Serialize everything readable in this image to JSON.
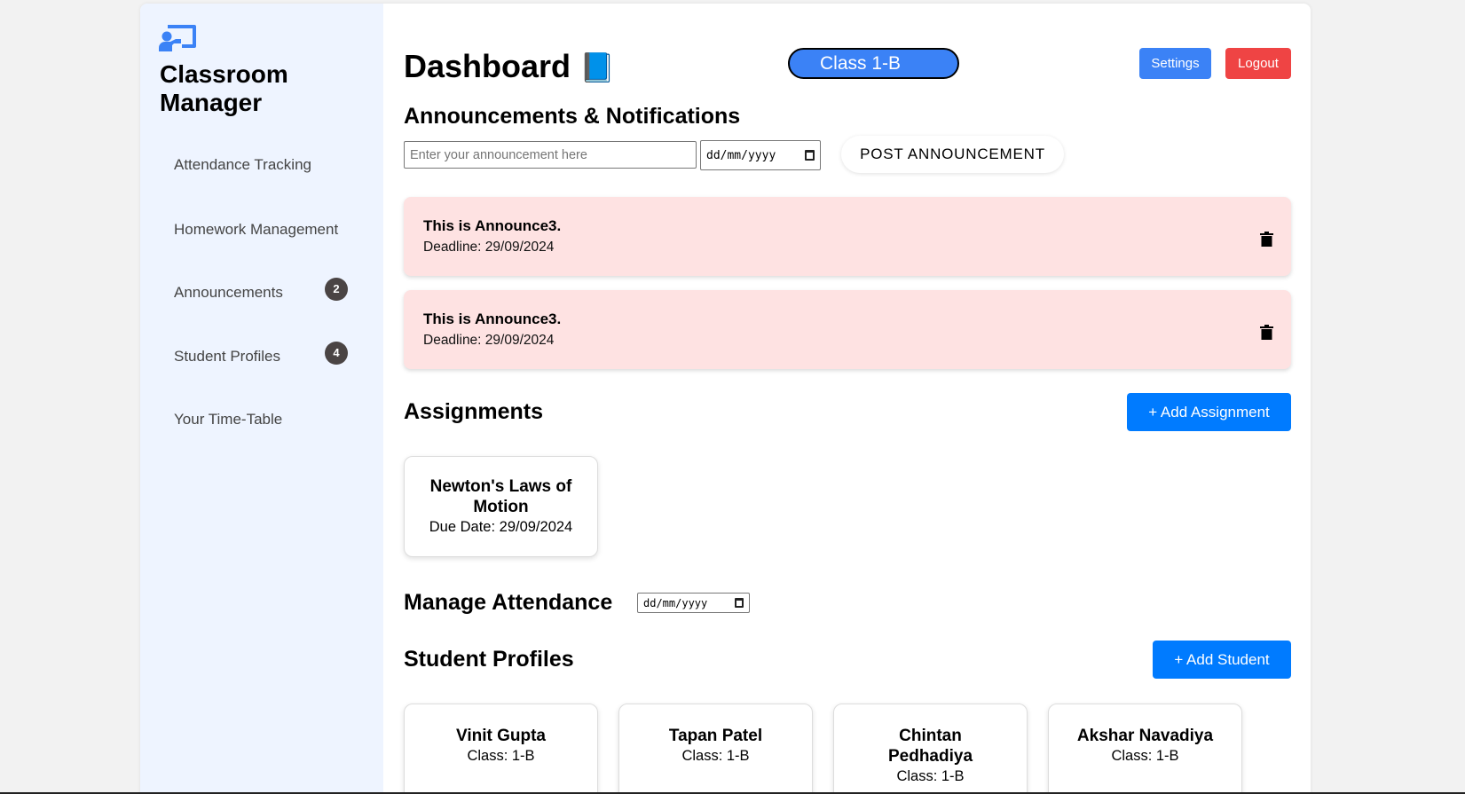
{
  "sidebar": {
    "brand": "Classroom Manager",
    "items": [
      {
        "label": "Attendance Tracking"
      },
      {
        "label": "Homework Management"
      },
      {
        "label": "Announcements",
        "badge": "2"
      },
      {
        "label": "Student Profiles",
        "badge": "4"
      },
      {
        "label": "Your Time-Table"
      }
    ]
  },
  "header": {
    "title": "Dashboard",
    "title_emoji": "📘",
    "class_label": "Class 1-B",
    "settings": "Settings",
    "logout": "Logout"
  },
  "announcements": {
    "heading": "Announcements & Notifications",
    "placeholder": "Enter your announcement here",
    "date_placeholder": "dd/mm/yyyy",
    "post": "POST ANNOUNCEMENT",
    "items": [
      {
        "text": "This is Announce3.",
        "deadline": "Deadline: 29/09/2024"
      },
      {
        "text": "This is Announce3.",
        "deadline": "Deadline: 29/09/2024"
      }
    ]
  },
  "assignments": {
    "heading": "Assignments",
    "add": "+ Add Assignment",
    "items": [
      {
        "title": "Newton's Laws of Motion",
        "due": "Due Date: 29/09/2024"
      }
    ]
  },
  "attendance": {
    "heading": "Manage Attendance",
    "date_placeholder": "dd/mm/yyyy"
  },
  "students": {
    "heading": "Student Profiles",
    "add": "+ Add Student",
    "items": [
      {
        "name": "Vinit Gupta",
        "class": "Class: 1-B"
      },
      {
        "name": "Tapan Patel",
        "class": "Class: 1-B"
      },
      {
        "name": "Chintan Pedhadiya",
        "class": "Class: 1-B"
      },
      {
        "name": "Akshar Navadiya",
        "class": "Class: 1-B"
      }
    ]
  },
  "colors": {
    "primary": "#3b82f6",
    "danger": "#ef4444",
    "action": "#007bff",
    "announcement_bg": "#fee2e2",
    "sidebar_bg": "#eef4ff"
  }
}
